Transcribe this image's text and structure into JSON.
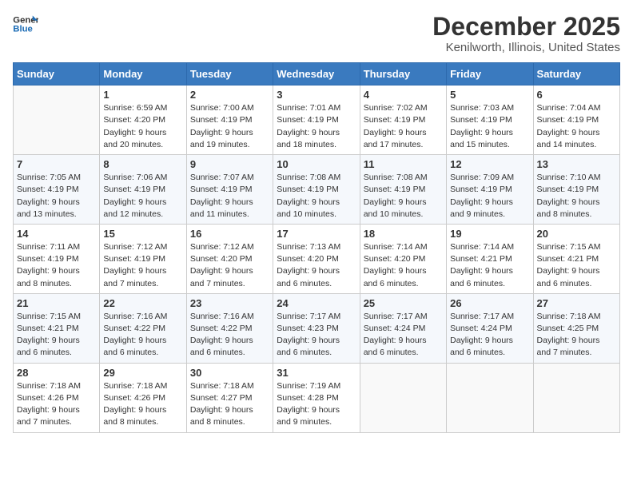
{
  "header": {
    "logo_line1": "General",
    "logo_line2": "Blue",
    "title": "December 2025",
    "subtitle": "Kenilworth, Illinois, United States"
  },
  "days_of_week": [
    "Sunday",
    "Monday",
    "Tuesday",
    "Wednesday",
    "Thursday",
    "Friday",
    "Saturday"
  ],
  "weeks": [
    [
      {
        "day": "",
        "info": ""
      },
      {
        "day": "1",
        "info": "Sunrise: 6:59 AM\nSunset: 4:20 PM\nDaylight: 9 hours\nand 20 minutes."
      },
      {
        "day": "2",
        "info": "Sunrise: 7:00 AM\nSunset: 4:19 PM\nDaylight: 9 hours\nand 19 minutes."
      },
      {
        "day": "3",
        "info": "Sunrise: 7:01 AM\nSunset: 4:19 PM\nDaylight: 9 hours\nand 18 minutes."
      },
      {
        "day": "4",
        "info": "Sunrise: 7:02 AM\nSunset: 4:19 PM\nDaylight: 9 hours\nand 17 minutes."
      },
      {
        "day": "5",
        "info": "Sunrise: 7:03 AM\nSunset: 4:19 PM\nDaylight: 9 hours\nand 15 minutes."
      },
      {
        "day": "6",
        "info": "Sunrise: 7:04 AM\nSunset: 4:19 PM\nDaylight: 9 hours\nand 14 minutes."
      }
    ],
    [
      {
        "day": "7",
        "info": "Sunrise: 7:05 AM\nSunset: 4:19 PM\nDaylight: 9 hours\nand 13 minutes."
      },
      {
        "day": "8",
        "info": "Sunrise: 7:06 AM\nSunset: 4:19 PM\nDaylight: 9 hours\nand 12 minutes."
      },
      {
        "day": "9",
        "info": "Sunrise: 7:07 AM\nSunset: 4:19 PM\nDaylight: 9 hours\nand 11 minutes."
      },
      {
        "day": "10",
        "info": "Sunrise: 7:08 AM\nSunset: 4:19 PM\nDaylight: 9 hours\nand 10 minutes."
      },
      {
        "day": "11",
        "info": "Sunrise: 7:08 AM\nSunset: 4:19 PM\nDaylight: 9 hours\nand 10 minutes."
      },
      {
        "day": "12",
        "info": "Sunrise: 7:09 AM\nSunset: 4:19 PM\nDaylight: 9 hours\nand 9 minutes."
      },
      {
        "day": "13",
        "info": "Sunrise: 7:10 AM\nSunset: 4:19 PM\nDaylight: 9 hours\nand 8 minutes."
      }
    ],
    [
      {
        "day": "14",
        "info": "Sunrise: 7:11 AM\nSunset: 4:19 PM\nDaylight: 9 hours\nand 8 minutes."
      },
      {
        "day": "15",
        "info": "Sunrise: 7:12 AM\nSunset: 4:19 PM\nDaylight: 9 hours\nand 7 minutes."
      },
      {
        "day": "16",
        "info": "Sunrise: 7:12 AM\nSunset: 4:20 PM\nDaylight: 9 hours\nand 7 minutes."
      },
      {
        "day": "17",
        "info": "Sunrise: 7:13 AM\nSunset: 4:20 PM\nDaylight: 9 hours\nand 6 minutes."
      },
      {
        "day": "18",
        "info": "Sunrise: 7:14 AM\nSunset: 4:20 PM\nDaylight: 9 hours\nand 6 minutes."
      },
      {
        "day": "19",
        "info": "Sunrise: 7:14 AM\nSunset: 4:21 PM\nDaylight: 9 hours\nand 6 minutes."
      },
      {
        "day": "20",
        "info": "Sunrise: 7:15 AM\nSunset: 4:21 PM\nDaylight: 9 hours\nand 6 minutes."
      }
    ],
    [
      {
        "day": "21",
        "info": "Sunrise: 7:15 AM\nSunset: 4:21 PM\nDaylight: 9 hours\nand 6 minutes."
      },
      {
        "day": "22",
        "info": "Sunrise: 7:16 AM\nSunset: 4:22 PM\nDaylight: 9 hours\nand 6 minutes."
      },
      {
        "day": "23",
        "info": "Sunrise: 7:16 AM\nSunset: 4:22 PM\nDaylight: 9 hours\nand 6 minutes."
      },
      {
        "day": "24",
        "info": "Sunrise: 7:17 AM\nSunset: 4:23 PM\nDaylight: 9 hours\nand 6 minutes."
      },
      {
        "day": "25",
        "info": "Sunrise: 7:17 AM\nSunset: 4:24 PM\nDaylight: 9 hours\nand 6 minutes."
      },
      {
        "day": "26",
        "info": "Sunrise: 7:17 AM\nSunset: 4:24 PM\nDaylight: 9 hours\nand 6 minutes."
      },
      {
        "day": "27",
        "info": "Sunrise: 7:18 AM\nSunset: 4:25 PM\nDaylight: 9 hours\nand 7 minutes."
      }
    ],
    [
      {
        "day": "28",
        "info": "Sunrise: 7:18 AM\nSunset: 4:26 PM\nDaylight: 9 hours\nand 7 minutes."
      },
      {
        "day": "29",
        "info": "Sunrise: 7:18 AM\nSunset: 4:26 PM\nDaylight: 9 hours\nand 8 minutes."
      },
      {
        "day": "30",
        "info": "Sunrise: 7:18 AM\nSunset: 4:27 PM\nDaylight: 9 hours\nand 8 minutes."
      },
      {
        "day": "31",
        "info": "Sunrise: 7:19 AM\nSunset: 4:28 PM\nDaylight: 9 hours\nand 9 minutes."
      },
      {
        "day": "",
        "info": ""
      },
      {
        "day": "",
        "info": ""
      },
      {
        "day": "",
        "info": ""
      }
    ]
  ]
}
